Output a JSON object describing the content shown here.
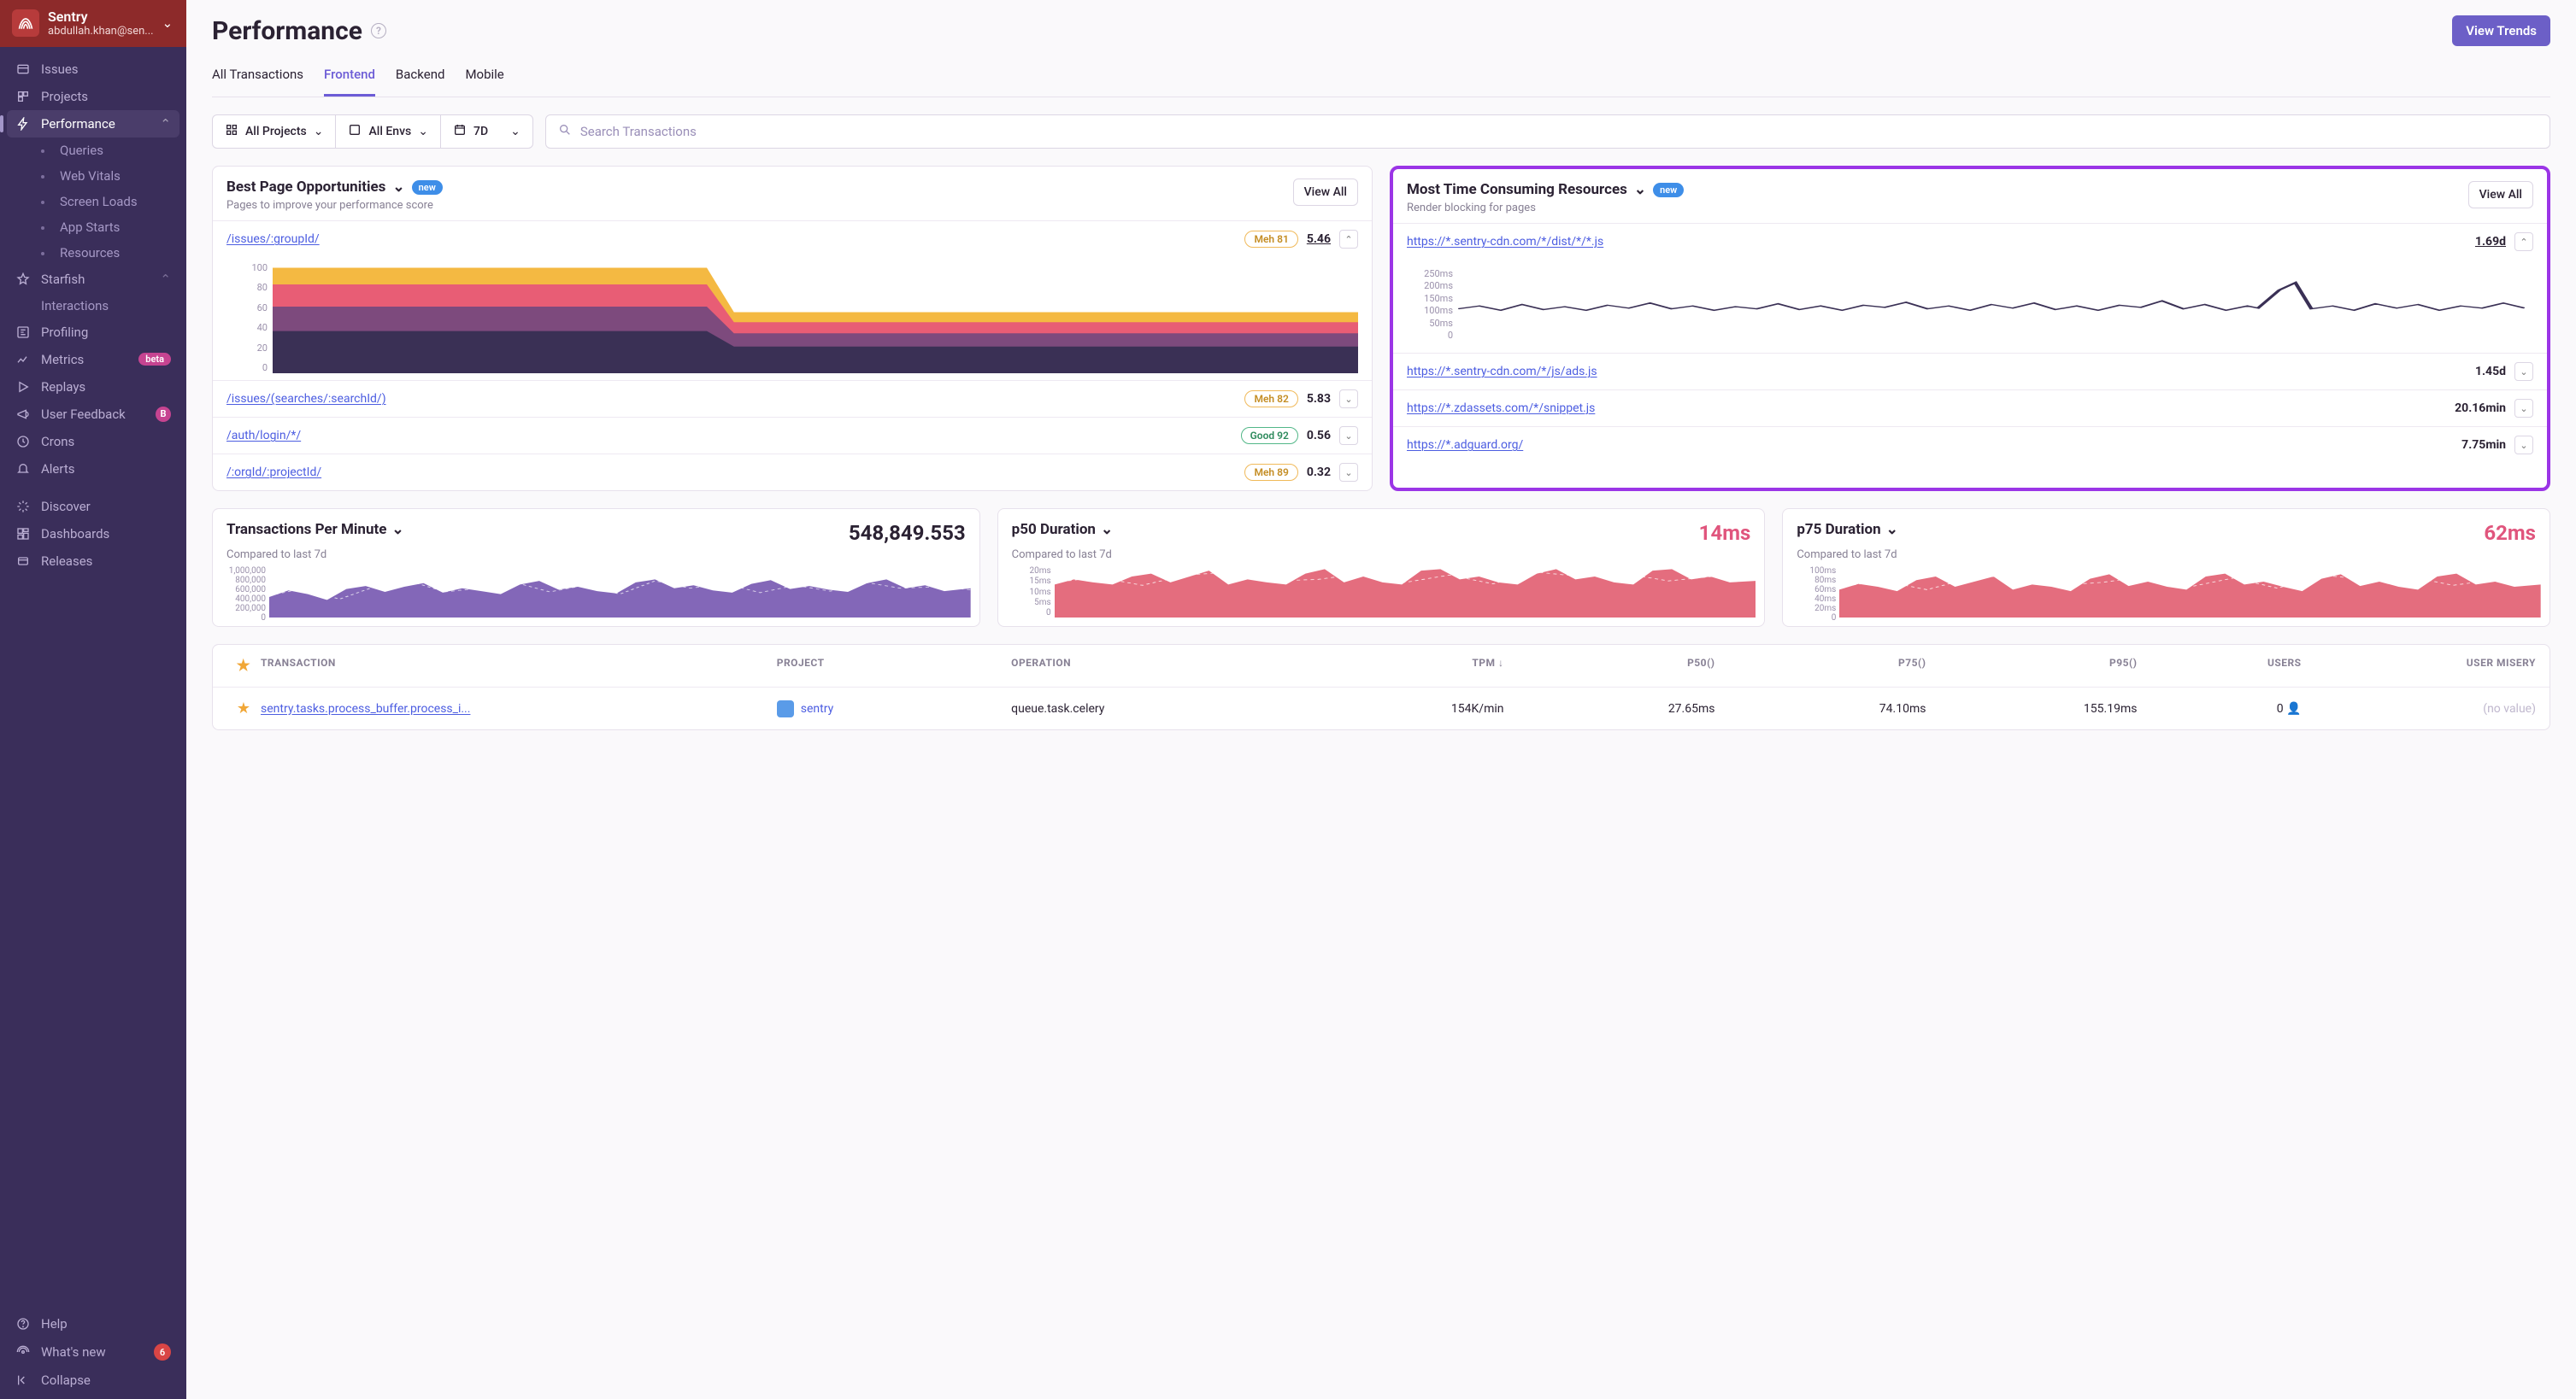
{
  "org": {
    "name": "Sentry",
    "user": "abdullah.khan@sen..."
  },
  "sidebar": {
    "issues": "Issues",
    "projects": "Projects",
    "performance": "Performance",
    "sub": [
      "Queries",
      "Web Vitals",
      "Screen Loads",
      "App Starts",
      "Resources"
    ],
    "starfish": "Starfish",
    "interactions": "Interactions",
    "profiling": "Profiling",
    "metrics": "Metrics",
    "beta": "beta",
    "replays": "Replays",
    "user_feedback": "User Feedback",
    "b": "B",
    "crons": "Crons",
    "alerts": "Alerts",
    "discover": "Discover",
    "dashboards": "Dashboards",
    "releases": "Releases",
    "help": "Help",
    "whatsnew": "What's new",
    "whatsnew_count": "6",
    "collapse": "Collapse"
  },
  "page": {
    "title": "Performance",
    "view_trends": "View Trends"
  },
  "tabs": [
    "All Transactions",
    "Frontend",
    "Backend",
    "Mobile"
  ],
  "filters": {
    "projects": "All Projects",
    "envs": "All Envs",
    "period": "7D",
    "search_placeholder": "Search Transactions"
  },
  "opportunities": {
    "title": "Best Page Opportunities",
    "new": "new",
    "sub": "Pages to improve your performance score",
    "view_all": "View All",
    "items": [
      {
        "path": "/issues/:groupId/",
        "badge": "Meh 81",
        "badge_class": "meh",
        "value": "5.46",
        "expanded": true
      },
      {
        "path": "/issues/(searches/:searchId/)",
        "badge": "Meh 82",
        "badge_class": "meh",
        "value": "5.83",
        "expanded": false
      },
      {
        "path": "/auth/login/*/",
        "badge": "Good 92",
        "badge_class": "good",
        "value": "0.56",
        "expanded": false
      },
      {
        "path": "/:orgId/:projectId/",
        "badge": "Meh 89",
        "badge_class": "meh",
        "value": "0.32",
        "expanded": false
      }
    ],
    "y_ticks": [
      "100",
      "80",
      "60",
      "40",
      "20",
      "0"
    ]
  },
  "resources": {
    "title": "Most Time Consuming Resources",
    "new": "new",
    "sub": "Render blocking for pages",
    "view_all": "View All",
    "items": [
      {
        "path": "https://*.sentry-cdn.com/*/dist/*/*.js",
        "value": "1.69d",
        "expanded": true
      },
      {
        "path": "https://*.sentry-cdn.com/*/js/ads.js",
        "value": "1.45d",
        "expanded": false
      },
      {
        "path": "https://*.zdassets.com/*/snippet.js",
        "value": "20.16min",
        "expanded": false
      },
      {
        "path": "https://*.adguard.org/",
        "value": "7.75min",
        "expanded": false
      }
    ],
    "y_ticks": [
      "250ms",
      "200ms",
      "150ms",
      "100ms",
      "50ms",
      "0"
    ]
  },
  "stats": {
    "tpm": {
      "title": "Transactions Per Minute",
      "value": "548,849.553",
      "sub": "Compared to last 7d",
      "y_ticks": [
        "1,000,000",
        "800,000",
        "600,000",
        "400,000",
        "200,000",
        "0"
      ]
    },
    "p50": {
      "title": "p50 Duration",
      "value": "14ms",
      "sub": "Compared to last 7d",
      "y_ticks": [
        "20ms",
        "15ms",
        "10ms",
        "5ms",
        "0"
      ]
    },
    "p75": {
      "title": "p75 Duration",
      "value": "62ms",
      "sub": "Compared to last 7d",
      "y_ticks": [
        "100ms",
        "80ms",
        "60ms",
        "40ms",
        "20ms",
        "0"
      ]
    }
  },
  "table": {
    "headers": [
      "TRANSACTION",
      "PROJECT",
      "OPERATION",
      "TPM ↓",
      "P50()",
      "P75()",
      "P95()",
      "USERS",
      "USER MISERY"
    ],
    "row": {
      "transaction": "sentry.tasks.process_buffer.process_i...",
      "project": "sentry",
      "operation": "queue.task.celery",
      "tpm": "154K/min",
      "p50": "27.65ms",
      "p75": "74.10ms",
      "p95": "155.19ms",
      "users": "0",
      "misery": "(no value)"
    }
  },
  "chart_data": [
    {
      "type": "area",
      "title": "Best Page Opportunities — /issues/:groupId/",
      "ylim": [
        0,
        100
      ],
      "x_range": "7d",
      "series": [
        {
          "name": "layer1",
          "values": [
            95,
            94,
            95,
            94,
            95,
            94,
            95,
            55,
            54,
            54,
            55,
            54,
            54,
            55,
            54,
            54
          ]
        },
        {
          "name": "layer2",
          "values": [
            80,
            79,
            80,
            79,
            80,
            79,
            80,
            46,
            45,
            45,
            46,
            45,
            45,
            46,
            45,
            45
          ]
        },
        {
          "name": "layer3",
          "values": [
            60,
            59,
            60,
            59,
            60,
            59,
            60,
            36,
            35,
            35,
            36,
            35,
            35,
            36,
            35,
            35
          ]
        },
        {
          "name": "layer4",
          "values": [
            38,
            37,
            38,
            37,
            38,
            37,
            38,
            24,
            23,
            23,
            24,
            23,
            23,
            24,
            23,
            23
          ]
        }
      ]
    },
    {
      "type": "line",
      "title": "Most Time Consuming Resources — sentry-cdn dist js",
      "ylabel": "ms",
      "ylim": [
        0,
        250
      ],
      "x_range": "7d",
      "series": [
        {
          "name": "duration",
          "values": [
            110,
            118,
            105,
            122,
            108,
            115,
            109,
            120,
            112,
            128,
            110,
            119,
            107,
            116,
            111,
            124,
            109,
            118,
            106,
            121,
            113,
            130,
            165,
            112,
            127,
            110,
            119,
            108,
            117,
            112,
            126,
            110,
            120,
            107
          ]
        }
      ]
    },
    {
      "type": "area",
      "title": "Transactions Per Minute",
      "ylim": [
        0,
        1000000
      ],
      "x_range": "7d",
      "series": [
        {
          "name": "tpm",
          "values": [
            420000,
            510000,
            460000,
            380000,
            530000,
            570000,
            490000,
            560000,
            610000,
            480000,
            540000,
            500000,
            460000,
            590000,
            640000,
            520000,
            560000,
            500000,
            470000,
            620000,
            660000,
            540000,
            580000,
            510000,
            480000,
            600000,
            650000,
            530000,
            570000,
            520000,
            490000,
            610000,
            660000,
            540000,
            580000,
            500000
          ]
        }
      ]
    },
    {
      "type": "area",
      "title": "p50 Duration",
      "ylabel": "ms",
      "ylim": [
        0,
        20
      ],
      "x_range": "7d",
      "series": [
        {
          "name": "p50",
          "values": [
            13,
            15,
            14,
            13,
            16,
            17,
            14,
            16,
            18,
            13,
            15,
            14,
            13,
            17,
            19,
            14,
            16,
            14,
            13,
            18,
            19,
            15,
            16,
            14,
            13,
            17,
            19,
            15,
            16,
            14,
            13,
            18,
            19,
            15,
            16,
            14
          ]
        }
      ]
    },
    {
      "type": "area",
      "title": "p75 Duration",
      "ylabel": "ms",
      "ylim": [
        0,
        100
      ],
      "x_range": "7d",
      "series": [
        {
          "name": "p75",
          "values": [
            55,
            65,
            60,
            52,
            72,
            78,
            60,
            70,
            80,
            54,
            64,
            60,
            52,
            76,
            84,
            62,
            70,
            60,
            54,
            80,
            86,
            64,
            70,
            60,
            52,
            76,
            84,
            62,
            70,
            60,
            54,
            80,
            86,
            64,
            70,
            60
          ]
        }
      ]
    }
  ]
}
